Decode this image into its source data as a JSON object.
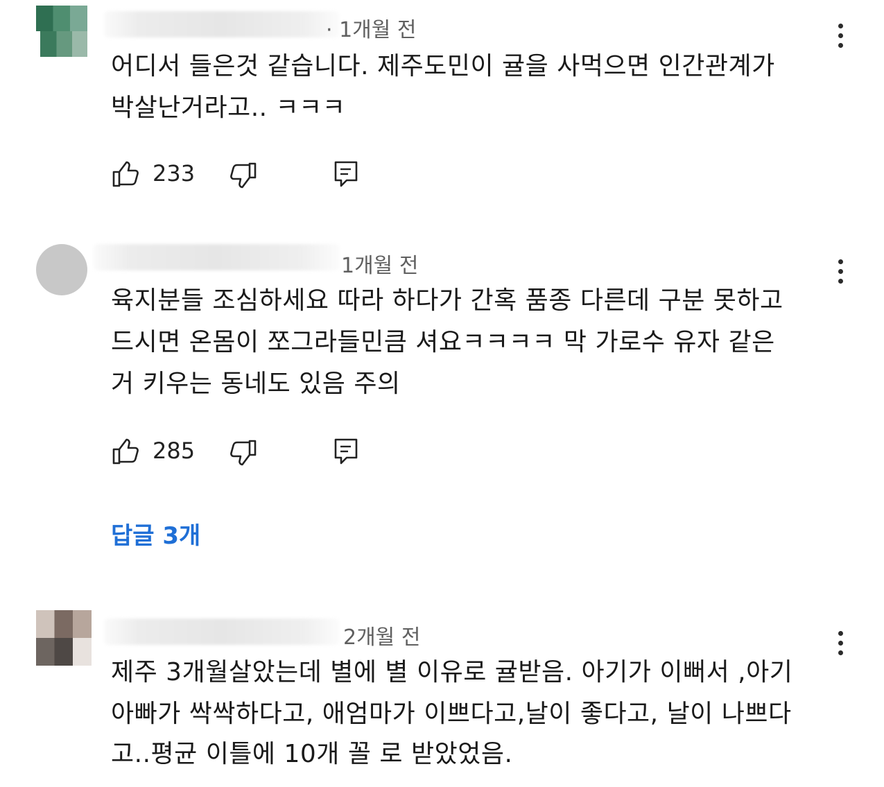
{
  "comments": [
    {
      "timestamp": "· 1개월 전",
      "lines": [
        "어디서 들은것 같습니다. 제주도민이 귤을 사먹으면 인간관계가",
        "박살난거라고.. ㅋㅋㅋ"
      ],
      "likes": "233"
    },
    {
      "timestamp": "1개월 전",
      "lines": [
        "육지분들 조심하세요 따라 하다가 간혹 품종 다른데 구분 못하고",
        "드시면 온몸이 쪼그라들민큼 셔요ㅋㅋㅋㅋ 막 가로수 유자 같은",
        "거 키우는 동네도 있음 주의"
      ],
      "likes": "285",
      "replies_label": "답글 3개"
    },
    {
      "timestamp": "2개월 전",
      "lines": [
        "제주 3개월살았는데 별에 별 이유로 귤받음. 아기가 이뻐서 ,아기",
        "아빠가 싹싹하다고, 애엄마가 이쁘다고,날이 좋다고, 날이 나쁘다",
        "고..평균 이틀에 10개 꼴 로 받았었음."
      ]
    }
  ],
  "icons": {
    "like": "thumb-up-icon",
    "dislike": "thumb-down-icon",
    "reply": "reply-icon",
    "menu": "more-vert-icon"
  },
  "colors": {
    "link": "#1f6fd6",
    "meta": "#606060",
    "text": "#1a1a1a"
  }
}
